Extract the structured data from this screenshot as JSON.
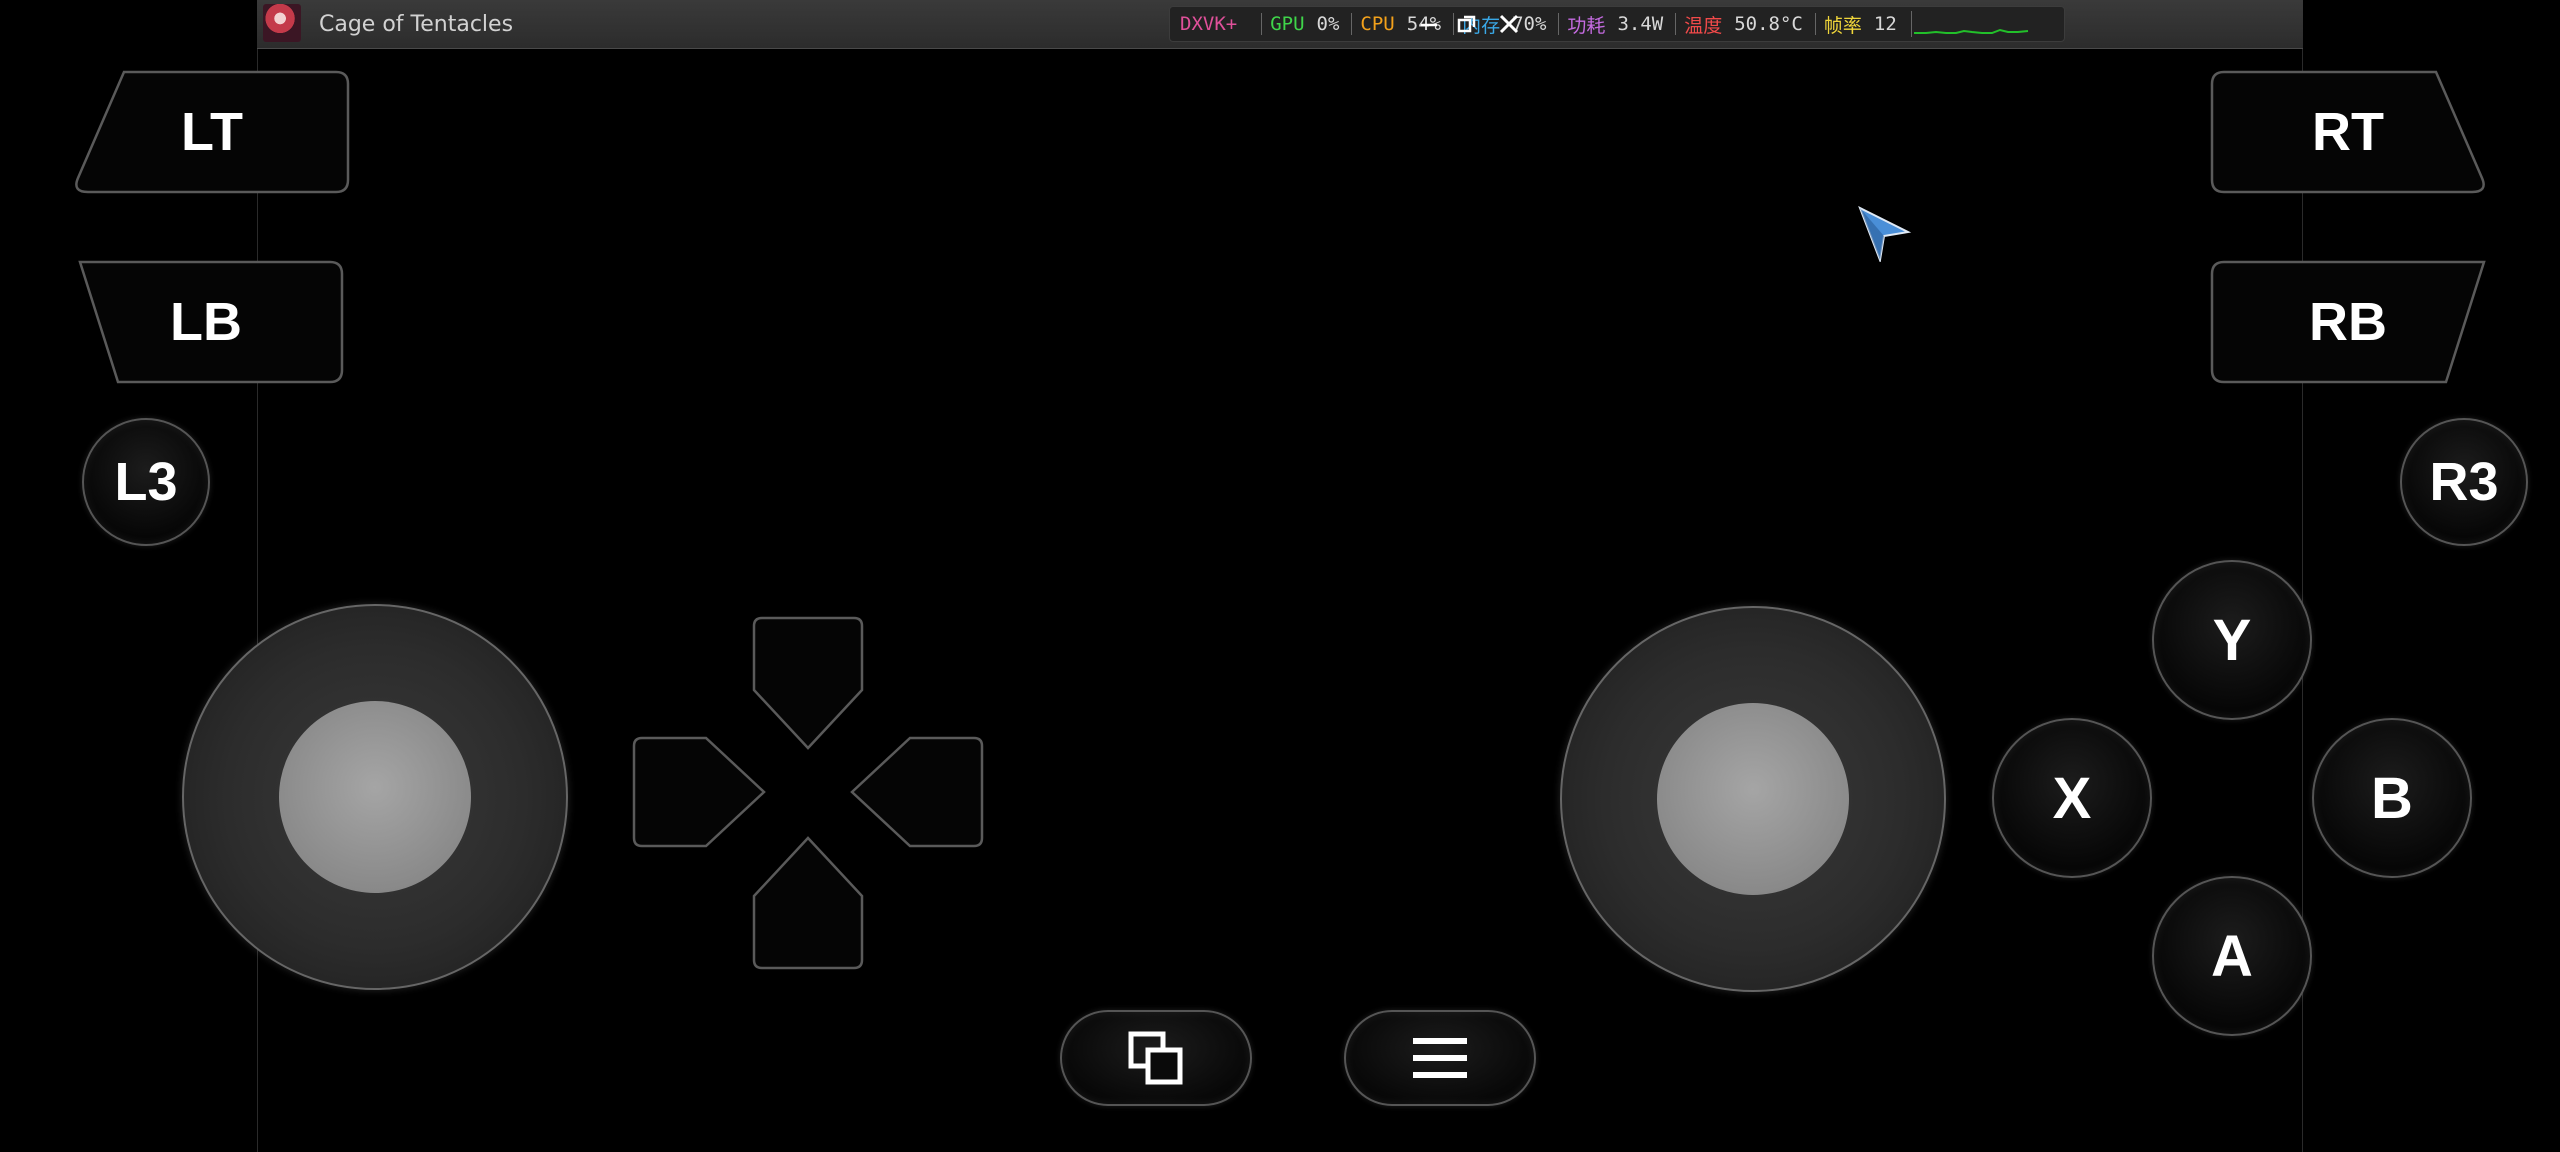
{
  "window": {
    "title": "Cage of Tentacles",
    "app_icon": "app-icon"
  },
  "perf_hud": {
    "items": [
      {
        "label": "DXVK+",
        "value": "",
        "color": "#e0509a"
      },
      {
        "label": "GPU",
        "value": "0%",
        "color": "#3fd54a"
      },
      {
        "label": "CPU",
        "value": "54%",
        "color": "#f3a11b"
      },
      {
        "label": "内存",
        "value": "70%",
        "color": "#3aa9e8"
      },
      {
        "label": "功耗",
        "value": "3.4W",
        "color": "#c46be0"
      },
      {
        "label": "温度",
        "value": "50.8°C",
        "color": "#f24a4a"
      },
      {
        "label": "帧率",
        "value": "12",
        "color": "#f0d63a"
      }
    ],
    "graph_color": "#22c02a"
  },
  "window_controls": {
    "minimize_icon": "minimize-icon",
    "restore_icon": "restore-icon",
    "close_icon": "close-icon"
  },
  "controller": {
    "left": {
      "lt": "LT",
      "lb": "LB",
      "l3": "L3"
    },
    "right": {
      "rt": "RT",
      "rb": "RB",
      "r3": "R3"
    },
    "face": {
      "y": "Y",
      "x": "X",
      "b": "B",
      "a": "A"
    },
    "bottom": {
      "view_icon": "view-windows-icon",
      "menu_icon": "menu-hamburger-icon"
    }
  },
  "pointer": {
    "icon": "mouse-cursor-icon",
    "color": "#4a8fd8"
  }
}
